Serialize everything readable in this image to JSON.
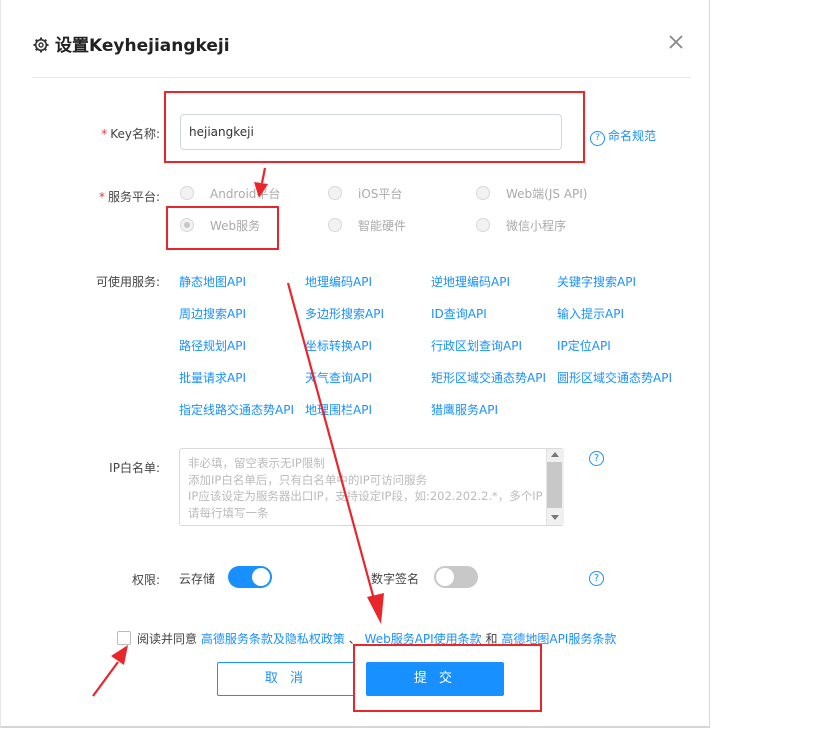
{
  "dialog": {
    "title": "设置Keyhejiangkeji",
    "icons": {
      "title": "gear-icon",
      "close": "close-icon",
      "help": "question-circle-icon"
    }
  },
  "form": {
    "key_name": {
      "label": "Key名称:",
      "value": "hejiangkeji",
      "help_link": "命名规范"
    },
    "platform": {
      "label": "服务平台:",
      "options": [
        "Android平台",
        "iOS平台",
        "Web端(JS API)",
        "Web服务",
        "智能硬件",
        "微信小程序"
      ],
      "selected": "Web服务"
    },
    "services": {
      "label": "可使用服务:",
      "items": [
        "静态地图API",
        "地理编码API",
        "逆地理编码API",
        "关键字搜索API",
        "周边搜索API",
        "多边形搜索API",
        "ID查询API",
        "输入提示API",
        "路径规划API",
        "坐标转换API",
        "行政区划查询API",
        "IP定位API",
        "批量请求API",
        "天气查询API",
        "矩形区域交通态势API",
        "圆形区域交通态势API",
        "指定线路交通态势API",
        "地理围栏API",
        "猎鹰服务API"
      ]
    },
    "ip_whitelist": {
      "label": "IP白名单:",
      "placeholder_lines": [
        "非必填，留空表示无IP限制",
        "添加IP白名单后，只有白名单中的IP可访问服务",
        "IP应该设定为服务器出口IP，支持设定IP段，如:202.202.2.*，多个IP",
        "请每行填写一条"
      ]
    },
    "permissions": {
      "label": "权限:",
      "cloud_storage": {
        "label": "云存储",
        "enabled": true
      },
      "digital_signature": {
        "label": "数字签名",
        "enabled": false
      }
    },
    "agreement": {
      "prefix": "阅读并同意",
      "link1": "高德服务条款及隐私权政策",
      "sep1": "、",
      "link2": "Web服务API使用条款",
      "sep2": "和",
      "link3": "高德地图API服务条款",
      "checked": false
    }
  },
  "buttons": {
    "cancel": "取 消",
    "submit": "提 交"
  },
  "colors": {
    "accent": "#1890ff",
    "annotation": "#e8262b",
    "required": "#e4393c"
  }
}
